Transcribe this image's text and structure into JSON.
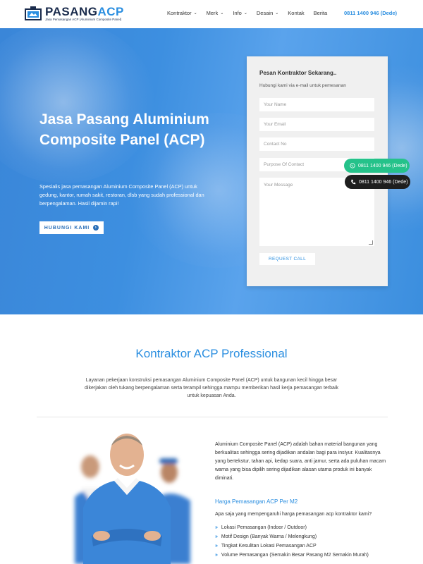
{
  "header": {
    "logo_title_a": "PASANG",
    "logo_title_b": "ACP",
    "logo_tagline": "Jasa Pemasangan ACP (Aluminium Composite Panel)",
    "nav": [
      {
        "label": "Kontraktor",
        "dropdown": true
      },
      {
        "label": "Merk",
        "dropdown": true
      },
      {
        "label": "Info",
        "dropdown": true
      },
      {
        "label": "Desain",
        "dropdown": true
      },
      {
        "label": "Kontak",
        "dropdown": false
      },
      {
        "label": "Berita",
        "dropdown": false
      }
    ],
    "phone": "0811 1400 946 (Dede)"
  },
  "hero": {
    "title": "Jasa Pasang Aluminium Composite Panel (ACP)",
    "description": "Spesialis jasa pemasangan Aluminium Composite Panel (ACP) untuk gedung, kantor, rumah sakit, restoran, dlsb yang sudah professional dan berpengalaman. Hasil dijamin rapi!",
    "button_label": "HUBUNGI KAMI"
  },
  "form": {
    "title": "Pesan Kontraktor Sekarang..",
    "subtitle": "Hubungi kami via e-mail untuk pemesanan",
    "name_placeholder": "Your Name",
    "email_placeholder": "Your Email",
    "contact_placeholder": "Contact No",
    "purpose_placeholder": "Purpose Of Contact",
    "message_placeholder": "Your Message",
    "submit_label": "REQUEST CALL"
  },
  "floating": {
    "whatsapp": "0811 1400 946 (Dede)",
    "phone": "0811 1400 946 (Dede)"
  },
  "section": {
    "title": "Kontraktor ACP Professional",
    "description": "Layanan pekerjaan konstruksi pemasangan Aluminium Composite Panel (ACP) untuk bangunan kecil hingga besar dikerjakan oleh tukang berpengalaman serta terampil sehingga mampu memberikan hasil kerja pemasangan terbaik untuk kepuasan Anda."
  },
  "content": {
    "paragraph": "Aluminium Composite Panel (ACP) adalah bahan material bangunan yang berkualitas sehingga sering dijadikan andalan bagi para insiyur. Kualitasnya yang bertekstur, tahan api, kedap suara, anti jamur, serta ada puluhan macam warna yang bisa dipilih sering dijadikan alasan utama produk ini banyak diminati.",
    "heading": "Harga Pemasangan ACP Per M2",
    "question": "Apa saja yang mempengaruhi harga pemasangan acp kontraktor kami?",
    "list": [
      "Lokasi Pemasangan (Indoor / Outdoor)",
      "Motif Design (Banyak Warna / Melengkung)",
      "Tingkat Kesulitan Lokasi Pemasangan ACP",
      "Volume Pemasangan (Semakin Besar Pasang M2 Semakin Murah)"
    ]
  },
  "colors": {
    "accent": "#2a8ee0",
    "whatsapp": "#25c28a",
    "dark": "#1e1e1e"
  }
}
